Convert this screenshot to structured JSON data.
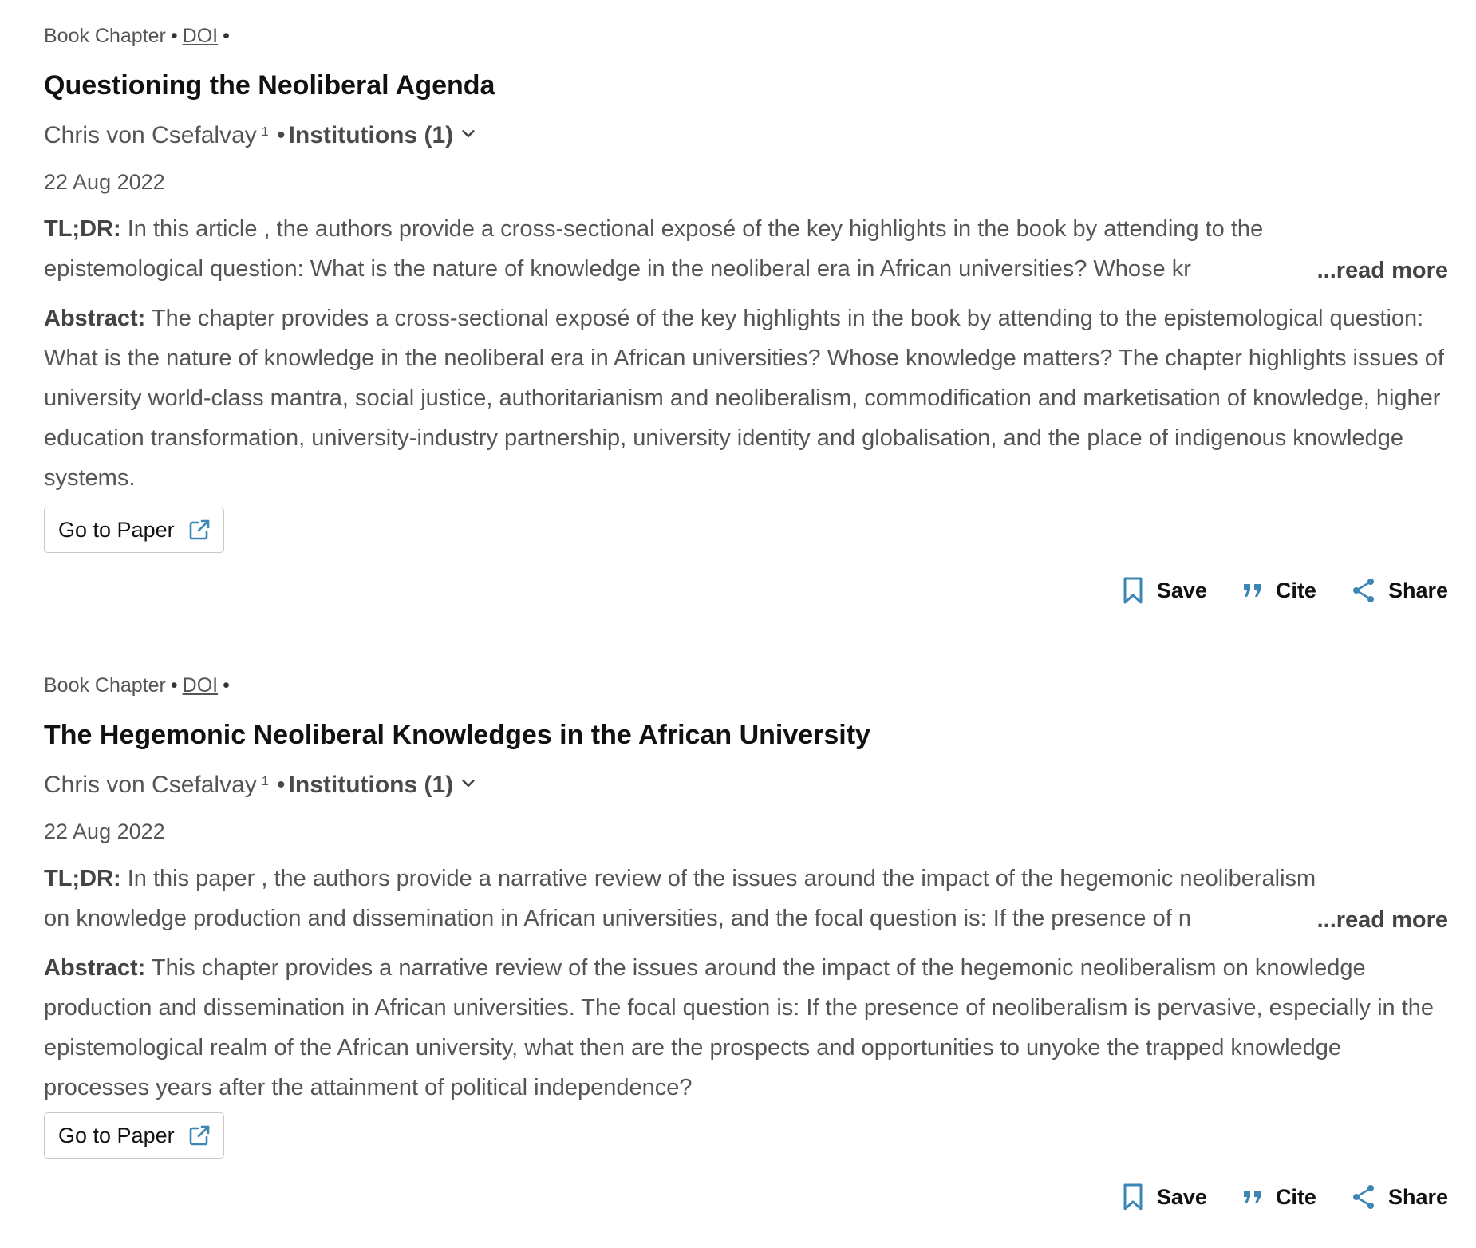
{
  "papers": [
    {
      "type_label": "Book Chapter",
      "doi_label": "DOI",
      "title": "Questioning the Neoliberal Agenda",
      "author": "Chris von Csefalvay",
      "author_sup": "1",
      "institutions": "Institutions (1)",
      "date": "22 Aug 2022",
      "tldr_label": "TL;DR:",
      "tldr_line1": "In this article , the authors provide a cross-sectional exposé of the key highlights in the book by attending to the",
      "tldr_line2": "epistemological question: What is the nature of knowledge in the neoliberal era in African universities? Whose kr",
      "read_more": "...read more",
      "abstract_label": "Abstract:",
      "abstract_text": "The chapter provides a cross-sectional exposé of the key highlights in the book by attending to the epistemological question: What is the nature of knowledge in the neoliberal era in African universities? Whose knowledge matters? The chapter highlights issues of university world-class mantra, social justice, authoritarianism and neoliberalism, commodification and marketisation of knowledge, higher education transformation, university-industry partnership, university identity and globalisation, and the place of indigenous knowledge systems.",
      "go_to_paper": "Go to Paper",
      "save": "Save",
      "cite": "Cite",
      "share": "Share"
    },
    {
      "type_label": "Book Chapter",
      "doi_label": "DOI",
      "title": "The Hegemonic Neoliberal Knowledges in the African University",
      "author": "Chris von Csefalvay",
      "author_sup": "1",
      "institutions": "Institutions (1)",
      "date": "22 Aug 2022",
      "tldr_label": "TL;DR:",
      "tldr_line1": "In this paper , the authors provide a narrative review of the issues around the impact of the hegemonic neoliberalism",
      "tldr_line2": "on knowledge production and dissemination in African universities, and the focal question is: If the presence of n",
      "read_more": "...read more",
      "abstract_label": "Abstract:",
      "abstract_text": "This chapter provides a narrative review of the issues around the impact of the hegemonic neoliberalism on knowledge production and dissemination in African universities. The focal question is: If the presence of neoliberalism is pervasive, especially in the epistemological realm of the African university, what then are the prospects and opportunities to unyoke the trapped knowledge processes years after the attainment of political independence?",
      "go_to_paper": "Go to Paper",
      "save": "Save",
      "cite": "Cite",
      "share": "Share"
    }
  ],
  "colors": {
    "accent": "#3b86b5",
    "title": "#111111",
    "body_text": "#555555"
  },
  "icons": {
    "go_to_paper": "external-link-icon",
    "institutions": "chevron-down-icon",
    "save": "bookmark-icon",
    "cite": "quote-icon",
    "share": "share-icon"
  }
}
